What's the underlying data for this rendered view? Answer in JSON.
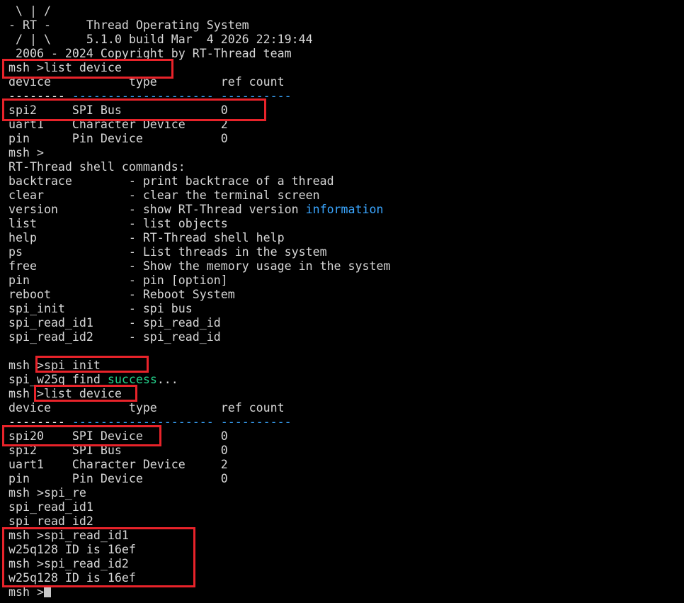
{
  "terminal": {
    "lines": [
      [
        {
          "t": " \\ | /"
        }
      ],
      [
        {
          "t": "- RT -     Thread Operating System"
        }
      ],
      [
        {
          "t": " / | \\     5.1.0 build Mar  4 2026 22:19:44"
        }
      ],
      [
        {
          "t": " 2006 - 2024 Copyright by RT-Thread team"
        }
      ],
      [
        {
          "t": "msh >list device"
        }
      ],
      [
        {
          "t": "device           type         ref count"
        }
      ],
      [
        {
          "t": "-------- ",
          "c": "sep-white"
        },
        {
          "t": "--------------------",
          "c": "sep-blue"
        },
        {
          "t": " ",
          "c": ""
        },
        {
          "t": "----------",
          "c": "sep-blue"
        }
      ],
      [
        {
          "t": "spi2     SPI Bus              0"
        }
      ],
      [
        {
          "t": "uart1    Character Device     2"
        }
      ],
      [
        {
          "t": "pin      Pin Device           0"
        }
      ],
      [
        {
          "t": "msh >"
        }
      ],
      [
        {
          "t": "RT-Thread shell commands:"
        }
      ],
      [
        {
          "t": "backtrace        - print backtrace of a thread"
        }
      ],
      [
        {
          "t": "clear            - clear the terminal screen"
        }
      ],
      [
        {
          "t": "version          - show RT-Thread version "
        },
        {
          "t": "information",
          "c": "info"
        }
      ],
      [
        {
          "t": "list             - list objects"
        }
      ],
      [
        {
          "t": "help             - RT-Thread shell help"
        }
      ],
      [
        {
          "t": "ps               - List threads in the system"
        }
      ],
      [
        {
          "t": "free             - Show the memory usage in the system"
        }
      ],
      [
        {
          "t": "pin              - pin [option]"
        }
      ],
      [
        {
          "t": "reboot           - Reboot System"
        }
      ],
      [
        {
          "t": "spi_init         - spi bus"
        }
      ],
      [
        {
          "t": "spi_read_id1     - spi_read_id"
        }
      ],
      [
        {
          "t": "spi_read_id2     - spi_read_id"
        }
      ],
      [
        {
          "t": ""
        }
      ],
      [
        {
          "t": "msh >spi_init"
        }
      ],
      [
        {
          "t": "spi_w25q find "
        },
        {
          "t": "success",
          "c": "success"
        },
        {
          "t": "..."
        }
      ],
      [
        {
          "t": "msh >list device"
        }
      ],
      [
        {
          "t": "device           type         ref count"
        }
      ],
      [
        {
          "t": "-------- ",
          "c": "sep-white"
        },
        {
          "t": "--------------------",
          "c": "sep-blue"
        },
        {
          "t": " ",
          "c": ""
        },
        {
          "t": "----------",
          "c": "sep-blue"
        }
      ],
      [
        {
          "t": "spi20    SPI Device           0"
        }
      ],
      [
        {
          "t": "spi2     SPI Bus              0"
        }
      ],
      [
        {
          "t": "uart1    Character Device     2"
        }
      ],
      [
        {
          "t": "pin      Pin Device           0"
        }
      ],
      [
        {
          "t": "msh >spi_re"
        }
      ],
      [
        {
          "t": "spi_read_id1"
        }
      ],
      [
        {
          "t": "spi_read_id2"
        }
      ],
      [
        {
          "t": "msh >spi_read_id1"
        }
      ],
      [
        {
          "t": "w25q128 ID is 16ef"
        }
      ],
      [
        {
          "t": "msh >spi_read_id2"
        }
      ],
      [
        {
          "t": "w25q128 ID is 16ef"
        }
      ],
      [
        {
          "t": "msh >"
        },
        {
          "t": "",
          "c": "cursor"
        }
      ]
    ]
  },
  "colors": {
    "background": "#000000",
    "text": "#d7d7d7",
    "highlight_box": "#e8232a",
    "info": "#3aa6ff",
    "success": "#23d18b",
    "separator_blue": "#3aa6ff"
  }
}
